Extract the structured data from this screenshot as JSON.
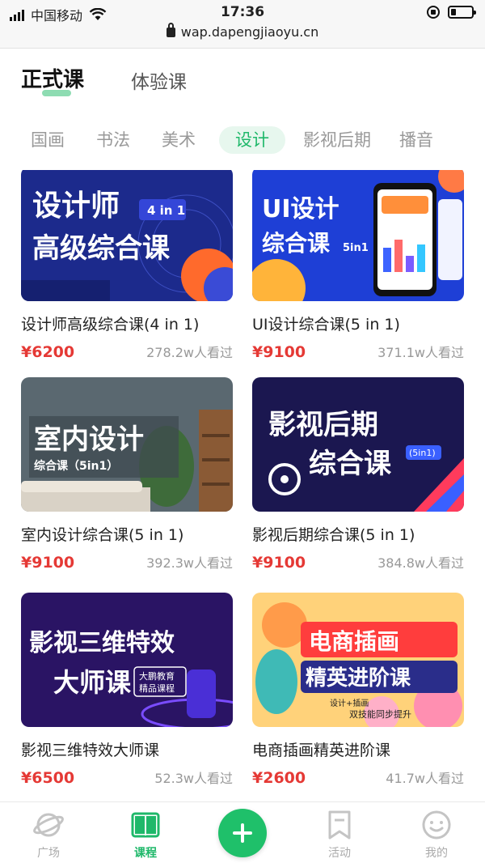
{
  "status_bar": {
    "carrier": "中国移动",
    "time": "17:36",
    "url": "wap.dapengjiaoyu.cn"
  },
  "main_tabs": [
    {
      "label": "正式课",
      "active": true
    },
    {
      "label": "体验课",
      "active": false
    }
  ],
  "categories": [
    {
      "label": "国画",
      "active": false
    },
    {
      "label": "书法",
      "active": false
    },
    {
      "label": "美术",
      "active": false
    },
    {
      "label": "设计",
      "active": true
    },
    {
      "label": "影视后期",
      "active": false
    },
    {
      "label": "播音",
      "active": false
    }
  ],
  "courses": [
    {
      "title": "设计师高级综合课(4 in 1)",
      "price": "¥6200",
      "views": "278.2w人看过",
      "banner": {
        "line1": "设计师",
        "line2": "高级综合课",
        "tag": "4 in 1"
      }
    },
    {
      "title": "UI设计综合课(5 in 1)",
      "price": "¥9100",
      "views": "371.1w人看过",
      "banner": {
        "line1": "UI设计",
        "line2": "综合课",
        "tag": "5in1"
      }
    },
    {
      "title": "室内设计综合课(5 in 1)",
      "price": "¥9100",
      "views": "392.3w人看过",
      "banner": {
        "line1": "室内设计",
        "line2": "综合课（5in1）"
      }
    },
    {
      "title": "影视后期综合课(5 in 1)",
      "price": "¥9100",
      "views": "384.8w人看过",
      "banner": {
        "line1": "影视后期",
        "line2": "综合课",
        "tag": "(5in1)"
      }
    },
    {
      "title": "影视三维特效大师课",
      "price": "¥6500",
      "views": "52.3w人看过",
      "banner": {
        "line1": "影视三维特效",
        "line2": "大师课",
        "tag1": "大鹏教育",
        "tag2": "精品课程"
      }
    },
    {
      "title": "电商插画精英进阶课",
      "price": "¥2600",
      "views": "41.7w人看过",
      "banner": {
        "line1": "电商插画",
        "line2": "精英进阶课",
        "tag1": "设计+插画",
        "tag2": "双技能同步提升"
      }
    }
  ],
  "bottom_nav": [
    {
      "label": "广场",
      "icon": "planet-icon",
      "active": false
    },
    {
      "label": "课程",
      "icon": "book-icon",
      "active": true
    },
    {
      "label": "",
      "icon": "plus-icon",
      "active": false
    },
    {
      "label": "活动",
      "icon": "bookmark-icon",
      "active": false
    },
    {
      "label": "我的",
      "icon": "smile-face-icon",
      "active": false
    }
  ],
  "colors": {
    "accent": "#1fb86a",
    "price": "#e53935",
    "muted": "#999999"
  }
}
